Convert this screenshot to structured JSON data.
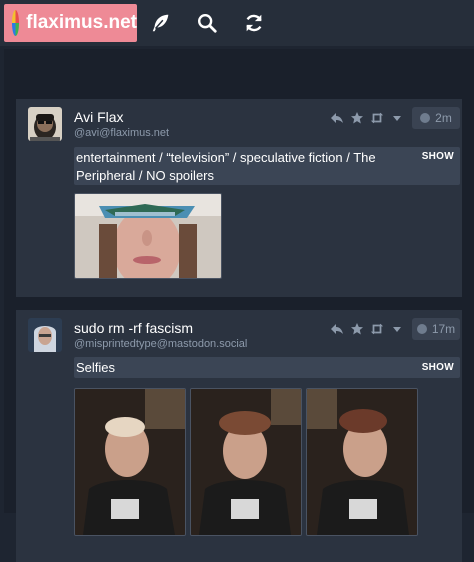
{
  "brand": {
    "name": "flaximus.net",
    "logo_icon": "flaximus-logo-icon"
  },
  "nav": [
    {
      "name": "compose",
      "icon": "feather-icon"
    },
    {
      "name": "search",
      "icon": "search-icon"
    },
    {
      "name": "refresh",
      "icon": "refresh-icon"
    }
  ],
  "statuses": [
    {
      "display_name": "Avi Flax",
      "acct": "@avi@flaximus.net",
      "time": "2m",
      "content_warning": "entertainment / “television” / speculative fiction / The Peripheral / NO spoilers",
      "show_label": "SHOW",
      "media_count": 1
    },
    {
      "display_name": "sudo rm -rf fascism",
      "acct": "@misprintedtype@mastodon.social",
      "time": "17m",
      "content_warning": "Selfies",
      "show_label": "SHOW",
      "media_count": 3
    }
  ],
  "colors": {
    "brand_bg": "#ee8a96",
    "card_bg": "#2b3340",
    "page_bg": "#1e2531",
    "cw_bg": "#3b4555",
    "muted": "#8d9aab"
  }
}
